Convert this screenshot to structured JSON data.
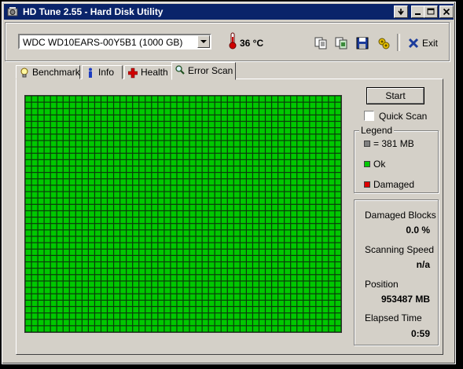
{
  "window": {
    "title": "HD Tune 2.55 - Hard Disk Utility",
    "titlebar_color": "#0a246a",
    "buttons": [
      "minimize-to-tray",
      "minimize",
      "maximize",
      "close"
    ]
  },
  "toolbar": {
    "drive": "WDC WD10EARS-00Y5B1 (1000 GB)",
    "temperature": "36 °C",
    "icons": [
      "copy-text-icon",
      "copy-screenshot-icon",
      "save-icon",
      "options-icon"
    ],
    "exit_label": "Exit"
  },
  "tabs": [
    {
      "label": "Benchmark",
      "icon": "bulb-icon",
      "active": false
    },
    {
      "label": "Info",
      "icon": "info-icon",
      "active": false
    },
    {
      "label": "Health",
      "icon": "health-cross-icon",
      "active": false
    },
    {
      "label": "Error Scan",
      "icon": "magnifier-icon",
      "active": true
    }
  ],
  "scan": {
    "start_label": "Start",
    "quick_scan_label": "Quick Scan",
    "quick_scan_checked": false,
    "block_colors": {
      "ok": "#00c800",
      "damaged": "#e00000",
      "unit": "#808080"
    },
    "grid_columns": 50,
    "grid_rows": 37,
    "damaged_block_count": 0
  },
  "legend": {
    "title": "Legend",
    "items": [
      {
        "label": "= 381 MB",
        "color": "#808080"
      },
      {
        "label": "Ok",
        "color": "#00c800"
      },
      {
        "label": "Damaged",
        "color": "#e00000"
      }
    ]
  },
  "stats": {
    "damaged_blocks_label": "Damaged Blocks",
    "damaged_blocks_value": "0.0 %",
    "scanning_speed_label": "Scanning Speed",
    "scanning_speed_value": "n/a",
    "position_label": "Position",
    "position_value": "953487 MB",
    "elapsed_time_label": "Elapsed Time",
    "elapsed_time_value": "0:59"
  }
}
